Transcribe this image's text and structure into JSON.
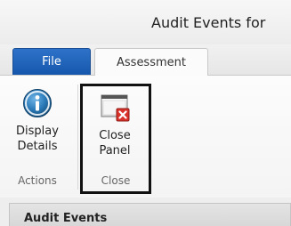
{
  "window": {
    "title": "Audit Events for"
  },
  "tabs": [
    {
      "label": "File",
      "active": false
    },
    {
      "label": "Assessment",
      "active": true
    }
  ],
  "ribbon": {
    "groups": [
      {
        "label": "Actions",
        "buttons": [
          {
            "label_line1": "Display",
            "label_line2": "Details",
            "icon": "info-icon"
          }
        ]
      },
      {
        "label": "Close",
        "highlighted": true,
        "buttons": [
          {
            "label_line1": "Close",
            "label_line2": "Panel",
            "icon": "close-panel-icon"
          }
        ]
      }
    ]
  },
  "panel": {
    "title": "Audit Events"
  },
  "colors": {
    "file_tab": "#1f62b8",
    "info_icon": "#2a7ab8",
    "close_badge": "#d9322b"
  }
}
